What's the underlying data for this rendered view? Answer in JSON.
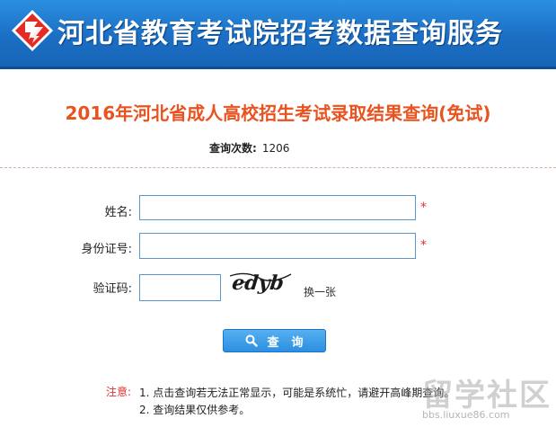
{
  "header": {
    "site_title": "河北省教育考试院招考数据查询服务",
    "logo_icon": "heb-exam-logo-icon"
  },
  "page": {
    "title": "2016年河北省成人高校招生考试录取结果查询(免试)",
    "query_count_label": "查询次数:",
    "query_count_value": "1206"
  },
  "form": {
    "name_label": "姓名:",
    "name_value": "",
    "idcard_label": "身份证号:",
    "idcard_value": "",
    "captcha_label": "验证码:",
    "captcha_value": "",
    "captcha_image_text": "edyb",
    "required_mark": "*",
    "refresh_label": "换一张",
    "submit_label": "查询",
    "submit_icon": "search-icon"
  },
  "notes": {
    "label": "注意:",
    "items": [
      "1. 点击查询若无法正常显示，可能是系统忙，请避开高峰期查询。",
      "2. 查询结果仅供参考。"
    ]
  },
  "watermark": {
    "text": "留学社区",
    "url": "bbs.liuxue86.com"
  },
  "colors": {
    "header_blue": "#1b6fc4",
    "title_orange": "#e8531f",
    "required_red": "#e03131",
    "button_blue": "#2c8fe0"
  }
}
